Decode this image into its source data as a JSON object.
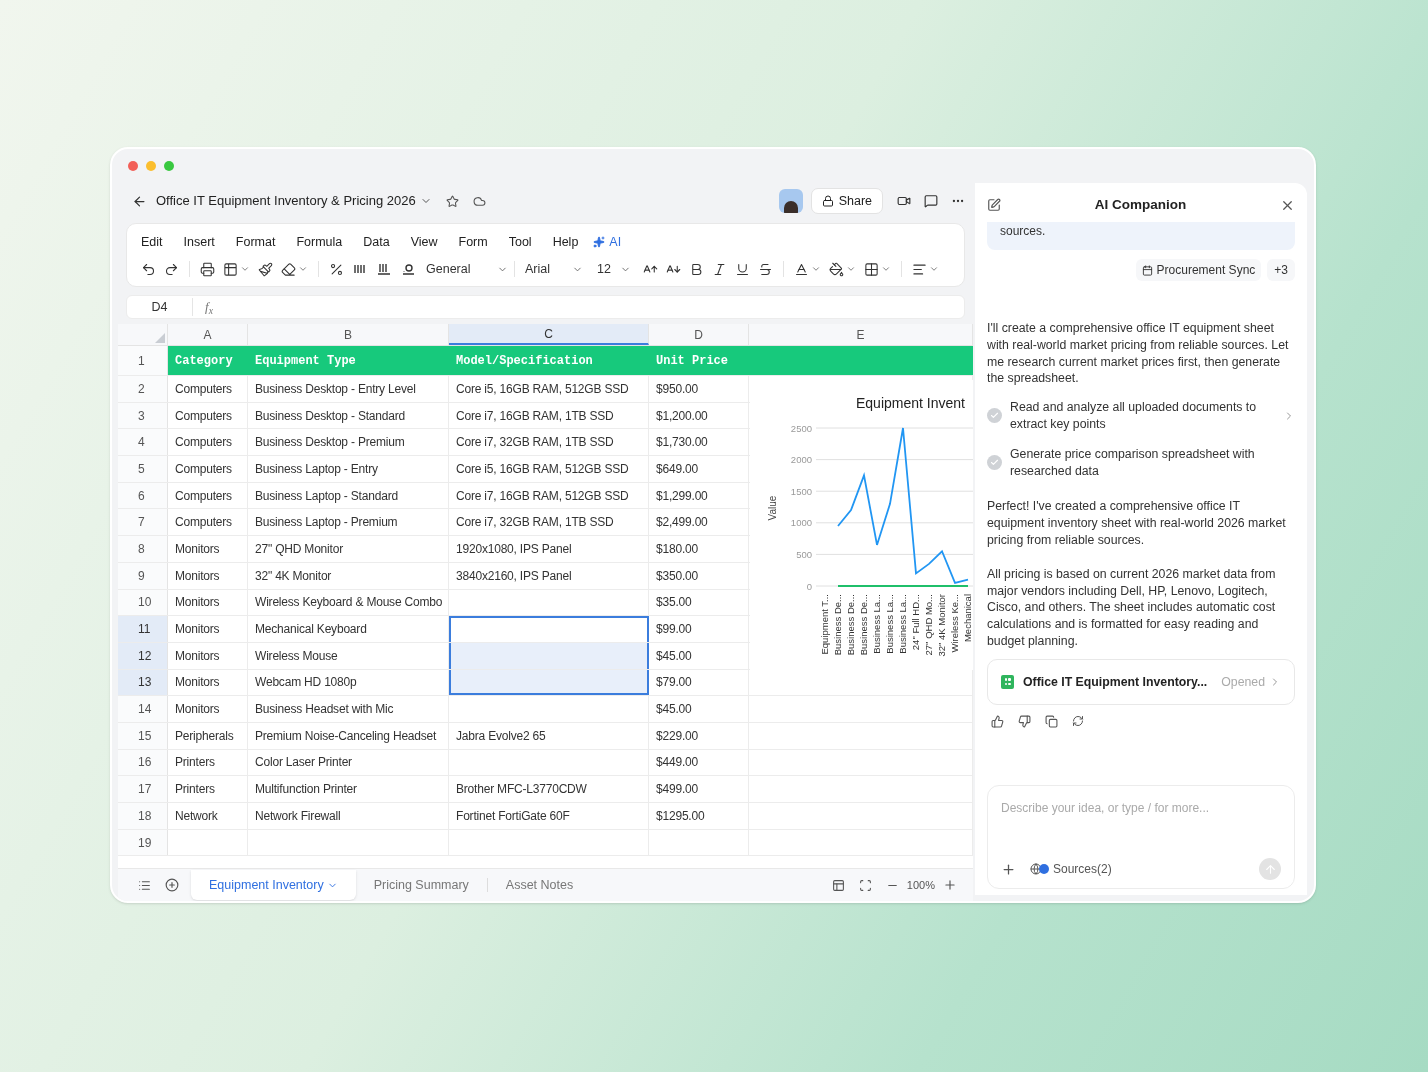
{
  "window": {
    "title": "Office IT Equipment Inventory & Pricing 2026"
  },
  "header": {
    "share": "Share"
  },
  "menu": [
    {
      "label": "Edit",
      "kind": "plain"
    },
    {
      "label": "Insert",
      "kind": "plain"
    },
    {
      "label": "Format",
      "kind": "plain"
    },
    {
      "label": "Formula",
      "kind": "plain"
    },
    {
      "label": "Data",
      "kind": "plain"
    },
    {
      "label": "View",
      "kind": "plain"
    },
    {
      "label": "Form",
      "kind": "plain"
    },
    {
      "label": "Tool",
      "kind": "plain"
    },
    {
      "label": "Help",
      "kind": "plain"
    },
    {
      "label": "AI",
      "kind": "ai"
    }
  ],
  "toolbar": {
    "number_format": "General",
    "font": "Arial",
    "font_size": "12"
  },
  "formula_bar": {
    "cell": "D4",
    "fx": "f$_{x}$"
  },
  "table": {
    "columns": [
      {
        "label": "A",
        "selected": false
      },
      {
        "label": "B",
        "selected": false
      },
      {
        "label": "C",
        "selected": true
      },
      {
        "label": "D",
        "selected": false
      },
      {
        "label": "E",
        "selected": false
      }
    ],
    "rows": [
      {
        "number": "1",
        "kind": "header",
        "selected": false,
        "cells": [
          "Category",
          "Equipment Type",
          "Model/Specification",
          "Unit Price"
        ]
      },
      {
        "number": "2",
        "kind": "data",
        "selected": false,
        "cells": [
          "Computers",
          "Business Desktop - Entry Level",
          "Core i5, 16GB RAM, 512GB SSD",
          "$950.00"
        ]
      },
      {
        "number": "3",
        "kind": "data",
        "selected": false,
        "cells": [
          "Computers",
          "Business Desktop - Standard",
          "Core i7, 16GB RAM, 1TB SSD",
          "$1,200.00"
        ]
      },
      {
        "number": "4",
        "kind": "data",
        "selected": false,
        "cells": [
          "Computers",
          "Business Desktop - Premium",
          "Core i7, 32GB RAM, 1TB SSD",
          "$1,730.00"
        ]
      },
      {
        "number": "5",
        "kind": "data",
        "selected": false,
        "cells": [
          "Computers",
          "Business Laptop - Entry",
          "Core i5, 16GB RAM, 512GB SSD",
          "$649.00"
        ]
      },
      {
        "number": "6",
        "kind": "data",
        "selected": false,
        "cells": [
          "Computers",
          "Business Laptop - Standard",
          "Core i7, 16GB RAM, 512GB SSD",
          "$1,299.00"
        ]
      },
      {
        "number": "7",
        "kind": "data",
        "selected": false,
        "cells": [
          "Computers",
          "Business Laptop - Premium",
          "Core i7, 32GB RAM, 1TB SSD",
          "$2,499.00"
        ]
      },
      {
        "number": "8",
        "kind": "data",
        "selected": false,
        "cells": [
          "Monitors",
          "27\" QHD Monitor",
          "1920x1080, IPS Panel",
          "$180.00"
        ]
      },
      {
        "number": "9",
        "kind": "data",
        "selected": false,
        "cells": [
          "Monitors",
          "32\" 4K Monitor",
          "3840x2160, IPS Panel",
          "$350.00"
        ]
      },
      {
        "number": "10",
        "kind": "data",
        "selected": false,
        "cells": [
          "Monitors",
          "Wireless Keyboard & Mouse Combo",
          null,
          "$35.00"
        ]
      },
      {
        "number": "11",
        "kind": "data",
        "selected": true,
        "cells": [
          "Monitors",
          "Mechanical Keyboard",
          null,
          "$99.00"
        ]
      },
      {
        "number": "12",
        "kind": "data",
        "selected": true,
        "cells": [
          "Monitors",
          "Wireless Mouse",
          null,
          "$45.00"
        ]
      },
      {
        "number": "13",
        "kind": "data",
        "selected": true,
        "cells": [
          "Monitors",
          "Webcam HD 1080p",
          null,
          "$79.00"
        ]
      },
      {
        "number": "14",
        "kind": "data",
        "selected": false,
        "cells": [
          "Monitors",
          "Business Headset with Mic",
          null,
          "$45.00"
        ]
      },
      {
        "number": "15",
        "kind": "data",
        "selected": false,
        "cells": [
          "Peripherals",
          "Premium Noise-Canceling Headset",
          "Jabra Evolve2 65",
          "$229.00"
        ]
      },
      {
        "number": "16",
        "kind": "data",
        "selected": false,
        "cells": [
          "Printers",
          "Color Laser Printer",
          null,
          "$449.00"
        ]
      },
      {
        "number": "17",
        "kind": "data",
        "selected": false,
        "cells": [
          "Printers",
          "Multifunction Printer",
          "Brother MFC-L3770CDW",
          "$499.00"
        ]
      },
      {
        "number": "18",
        "kind": "data",
        "selected": false,
        "cells": [
          "Network",
          "Network Firewall",
          "Fortinet FortiGate 60F",
          "$1295.00"
        ]
      },
      {
        "number": "19",
        "kind": "data",
        "selected": false,
        "cells": [
          null,
          null,
          null,
          null
        ]
      }
    ]
  },
  "chart_data": {
    "type": "line",
    "title": "Equipment Invent",
    "ylabel": "Value",
    "categories": [
      "Equipment T...",
      "Business De...",
      "Business De...",
      "Business De...",
      "Business La...",
      "Business La...",
      "Business La...",
      "24\" Full HD...",
      "27\" QHD Mo...",
      "32\" 4K Monitor",
      "Wireless Ke...",
      "Mechanical"
    ],
    "series": [
      {
        "color": "#2196f3",
        "values": [
          null,
          950,
          1200,
          1750,
          650,
          1300,
          2500,
          200,
          350,
          550,
          50,
          100
        ]
      },
      {
        "color": "#1fbf6a",
        "values": [
          null,
          0,
          0,
          0,
          0,
          0,
          0,
          0,
          0,
          0,
          0,
          0
        ]
      }
    ],
    "grid": true,
    "ylim": [
      0,
      2500
    ],
    "yticks": [
      0,
      500,
      1000,
      1500,
      2000,
      2500
    ]
  },
  "sheet_tabs": [
    {
      "label": "Equipment Inventory",
      "selected": true
    },
    {
      "label": "Pricing Summary",
      "selected": false
    },
    {
      "label": "Asset Notes",
      "selected": false
    }
  ],
  "zoom": "100%",
  "ai_panel": {
    "title": "AI Companion",
    "user_bubble": "sources.",
    "attachments": [
      {
        "kind": "calendar",
        "label": "Procurement Sync"
      },
      {
        "kind": "count",
        "label": "+3"
      }
    ],
    "intro": "I'll create a comprehensive office IT equipment sheet with real-world market pricing from reliable sources. Let me research current market prices first, then generate the spreadsheet.",
    "steps": [
      {
        "text": "Read and analyze all uploaded documents to extract key points",
        "done": true,
        "expandable": true
      },
      {
        "text": "Generate price comparison spreadsheet with researched data",
        "done": true,
        "expandable": false
      }
    ],
    "paragraphs": [
      "Perfect! I've created a comprehensive office IT equipment inventory sheet with real-world 2026 market pricing from reliable sources.",
      "All pricing is based on current 2026 market data from major vendors including Dell, HP, Lenovo, Logitech, Cisco, and others. The sheet includes automatic cost calculations and is formatted for easy reading and budget planning."
    ],
    "file_card": {
      "name": "Office IT Equipment Inventory...",
      "status": "Opened"
    },
    "input": {
      "placeholder": "Describe your idea, or type / for more...",
      "sources": "Sources(2)"
    }
  }
}
